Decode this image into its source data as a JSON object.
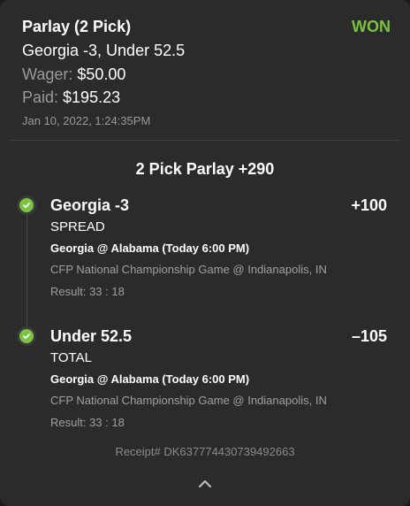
{
  "bet": {
    "title": "Parlay (2 Pick)",
    "status": "WON",
    "selection_summary": "Georgia -3, Under 52.5",
    "wager_label": "Wager:",
    "wager_value": "$50.00",
    "paid_label": "Paid:",
    "paid_value": "$195.23",
    "placed_at": "Jan 10, 2022, 1:24:35PM"
  },
  "parlay": {
    "heading": "2 Pick Parlay +290",
    "legs": [
      {
        "pick": "Georgia -3",
        "odds": "+100",
        "market": "SPREAD",
        "matchup": "Georgia @ Alabama (Today 6:00 PM)",
        "event": "CFP National Championship Game @ Indianapolis, IN",
        "result": "Result: 33 : 18"
      },
      {
        "pick": "Under 52.5",
        "odds": "–105",
        "market": "TOTAL",
        "matchup": "Georgia @ Alabama (Today 6:00 PM)",
        "event": "CFP National Championship Game @ Indianapolis, IN",
        "result": "Result: 33 : 18"
      }
    ]
  },
  "receipt": "Receipt# DK637774430739492663",
  "colors": {
    "won": "#7cc242",
    "background": "#2b2b2b",
    "muted_text": "#9a9a9a"
  },
  "icons": {
    "leg_status": "check-circle-icon",
    "collapse": "chevron-up-icon"
  }
}
